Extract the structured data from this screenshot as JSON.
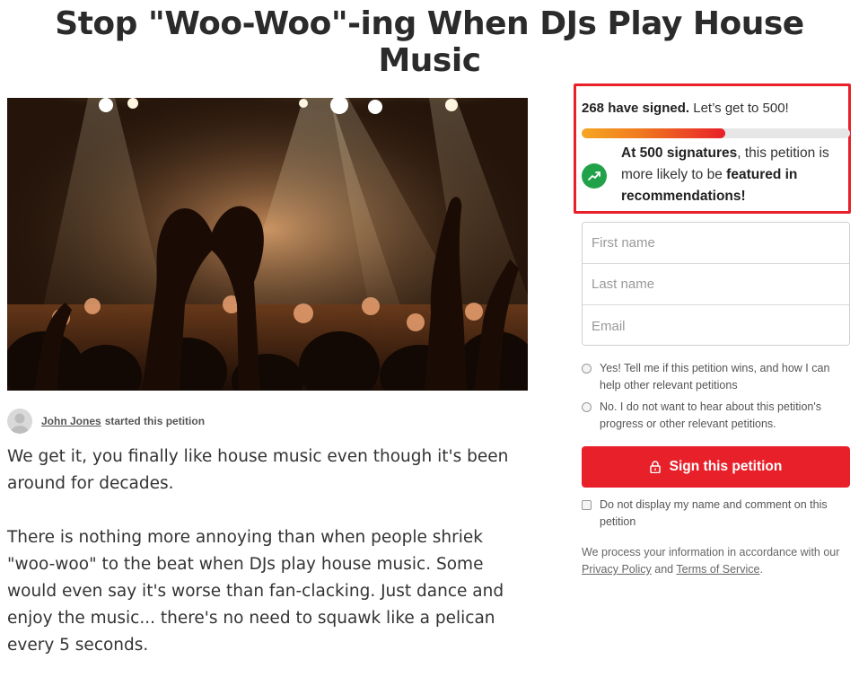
{
  "petition": {
    "title": "Stop \"Woo-Woo\"-ing When DJs Play House Music",
    "starter_name": "John Jones",
    "starter_suffix": "started this petition",
    "paragraphs": [
      "We get it, you finally like house music even though it's been around for decades.",
      "There is nothing more annoying than when people shriek \"woo-woo\" to the beat when DJs play house music. Some would even say it's worse than fan-clacking. Just dance and enjoy the music... there's no need to squawk like a pelican every 5 seconds."
    ]
  },
  "signatures": {
    "count_bold": "268 have signed.",
    "goal_text": "Let’s get to 500!",
    "progress_fraction": 0.536,
    "goal_bold": "At 500 signatures",
    "goal_middle": ", this petition is more likely to be ",
    "goal_bold2": "featured in recommendations!"
  },
  "form": {
    "first_name_placeholder": "First name",
    "last_name_placeholder": "Last name",
    "email_placeholder": "Email",
    "opt_in_label": "Yes! Tell me if this petition wins, and how I can help other relevant petitions",
    "opt_out_label": "No. I do not want to hear about this petition's progress or other relevant petitions.",
    "sign_button": "Sign this petition",
    "hide_name_label": "Do not display my name and comment on this petition",
    "privacy_prefix": "We process your information in accordance with our ",
    "privacy_link": "Privacy Policy",
    "privacy_and": " and ",
    "terms_link": "Terms of Service",
    "privacy_suffix": "."
  },
  "colors": {
    "accent_red": "#e8202a",
    "trend_green": "#21a24a",
    "progress_start": "#f5a623"
  },
  "icons": {
    "trend": "trending-up-icon",
    "lock": "lock-icon",
    "avatar": "user-avatar"
  }
}
